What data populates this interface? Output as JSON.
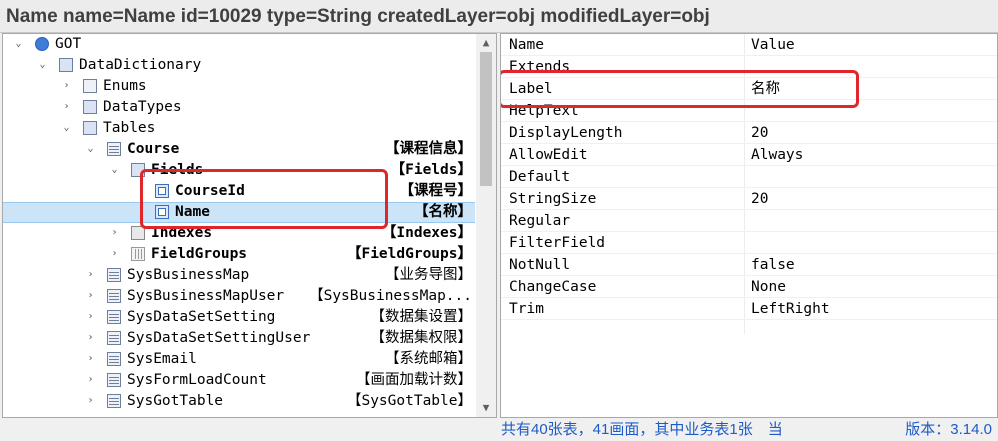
{
  "window_title": "Name name=Name id=10029 type=String createdLayer=obj modifiedLayer=obj",
  "tree": {
    "nodes": [
      {
        "name": "GOT",
        "caption": "",
        "expanded": true
      },
      {
        "name": "DataDictionary",
        "caption": "",
        "expanded": true
      },
      {
        "name": "Enums",
        "caption": "",
        "expanded": false
      },
      {
        "name": "DataTypes",
        "caption": "",
        "expanded": false
      },
      {
        "name": "Tables",
        "caption": "",
        "expanded": true
      },
      {
        "name": "Course",
        "caption": "【课程信息】",
        "expanded": true
      },
      {
        "name": "Fields",
        "caption": "【Fields】",
        "expanded": true
      },
      {
        "name": "CourseId",
        "caption": "【课程号】"
      },
      {
        "name": "Name",
        "caption": "【名称】",
        "selected": true
      },
      {
        "name": "Indexes",
        "caption": "【Indexes】",
        "expanded": false
      },
      {
        "name": "FieldGroups",
        "caption": "【FieldGroups】",
        "expanded": false
      },
      {
        "name": "SysBusinessMap",
        "caption": "【业务导图】",
        "expanded": false
      },
      {
        "name": "SysBusinessMapUser",
        "caption": "【SysBusinessMap...",
        "expanded": false
      },
      {
        "name": "SysDataSetSetting",
        "caption": "【数据集设置】",
        "expanded": false
      },
      {
        "name": "SysDataSetSettingUser",
        "caption": "【数据集权限】",
        "expanded": false
      },
      {
        "name": "SysEmail",
        "caption": "【系统邮箱】",
        "expanded": false
      },
      {
        "name": "SysFormLoadCount",
        "caption": "【画面加载计数】",
        "expanded": false
      },
      {
        "name": "SysGotTable",
        "caption": "【SysGotTable】",
        "expanded": false
      }
    ]
  },
  "properties": {
    "rows": [
      {
        "key": "Name",
        "value": "Value"
      },
      {
        "key": "Extends",
        "value": ""
      },
      {
        "key": "Label",
        "value": "名称"
      },
      {
        "key": "HelpText",
        "value": ""
      },
      {
        "key": "DisplayLength",
        "value": "20"
      },
      {
        "key": "AllowEdit",
        "value": "Always"
      },
      {
        "key": "Default",
        "value": ""
      },
      {
        "key": "StringSize",
        "value": "20"
      },
      {
        "key": "Regular",
        "value": ""
      },
      {
        "key": "FilterField",
        "value": ""
      },
      {
        "key": "NotNull",
        "value": "false"
      },
      {
        "key": "ChangeCase",
        "value": "None"
      },
      {
        "key": "Trim",
        "value": "LeftRight"
      }
    ]
  },
  "status": {
    "summary": "共有40张表，41画面，其中业务表1张　当",
    "version": "版本：3.14.0"
  },
  "colors": {
    "highlight": "#e0262a",
    "status_text": "#1d5bc9",
    "selection": "#cce4f7"
  }
}
